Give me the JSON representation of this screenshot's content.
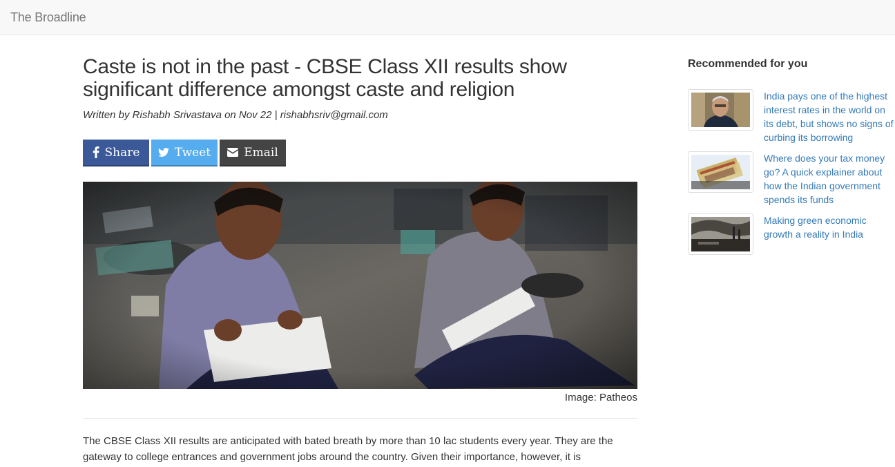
{
  "navbar": {
    "brand": "The Broadline"
  },
  "article": {
    "title": "Caste is not in the past - CBSE Class XII results show significant difference amongst caste and religion",
    "byline": "Written by Rishabh Srivastava on Nov 22 | rishabhsriv@gmail.com",
    "share": {
      "facebook_label": "Share",
      "twitter_label": "Tweet",
      "email_label": "Email",
      "facebook_color": "#3b5998",
      "twitter_color": "#55acee",
      "email_color": "#444444"
    },
    "image_caption": "Image: Patheos",
    "body": "The CBSE Class XII results are anticipated with bated breath by more than 10 lac students every year. They are the gateway to college entrances and government jobs around the country. Given their importance, however, it is"
  },
  "sidebar": {
    "heading": "Recommended for you",
    "items": [
      {
        "title": "India pays one of the highest interest rates in the world on its debt, but shows no signs of curbing its borrowing"
      },
      {
        "title": "Where does your tax money go? A quick explainer about how the Indian government spends its funds"
      },
      {
        "title": "Making green economic growth a reality in India"
      }
    ]
  },
  "colors": {
    "link": "#337ab7",
    "navbar_bg": "#f8f8f8"
  }
}
